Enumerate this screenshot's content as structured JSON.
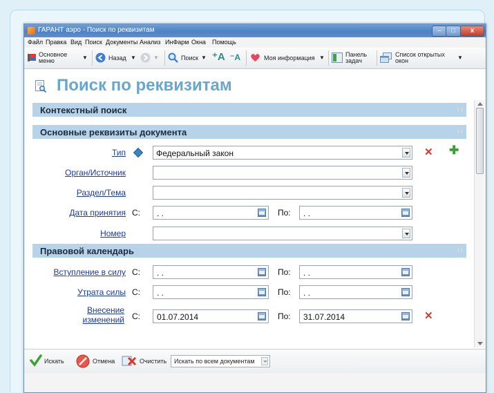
{
  "window": {
    "title": "ГАРАНТ аэро - Поиск по реквизитам"
  },
  "menu": [
    "Файл",
    "Правка",
    "Вид",
    "Поиск",
    "Документы",
    "Анализ",
    "ИнФарм",
    "Окна",
    "Помощь"
  ],
  "toolbar": {
    "main_menu_l1": "Основное",
    "main_menu_l2": "меню",
    "back": "Назад",
    "search": "Поиск",
    "my_info": "Моя информация",
    "task_panel_l1": "Панель",
    "task_panel_l2": "задач",
    "open_windows_l1": "Список открытых",
    "open_windows_l2": "окон"
  },
  "page": {
    "title": "Поиск по реквизитам"
  },
  "sections": {
    "context": "Контекстный поиск",
    "basic": "Основные реквизиты документа",
    "calendar": "Правовой календарь"
  },
  "fields": {
    "type_label": "Тип",
    "type_value": "Федеральный закон",
    "organ_label": "Орган/Источник",
    "organ_value": "",
    "section_label": "Раздел/Тема",
    "section_value": "",
    "adopt_label": "Дата принятия",
    "number_label": "Номер",
    "number_value": "",
    "entry_label": "Вступление в силу",
    "loss_label": "Утрата силы",
    "changes_l1": "Внесение",
    "changes_l2": "изменений",
    "from": "С:",
    "to": "По:",
    "empty_date": ". .",
    "changes_from": "01.07.2014",
    "changes_to": "31.07.2014"
  },
  "bottom": {
    "search": "Искать",
    "cancel": "Отмена",
    "clear": "Очистить",
    "scope": "Искать по всем документам"
  },
  "colors": {
    "title_blue": "#6aa5cc",
    "section_bg": "#b7d3e9",
    "link_blue": "#1a39a8",
    "delete_red": "#d9362a",
    "add_green": "#3aa234"
  }
}
